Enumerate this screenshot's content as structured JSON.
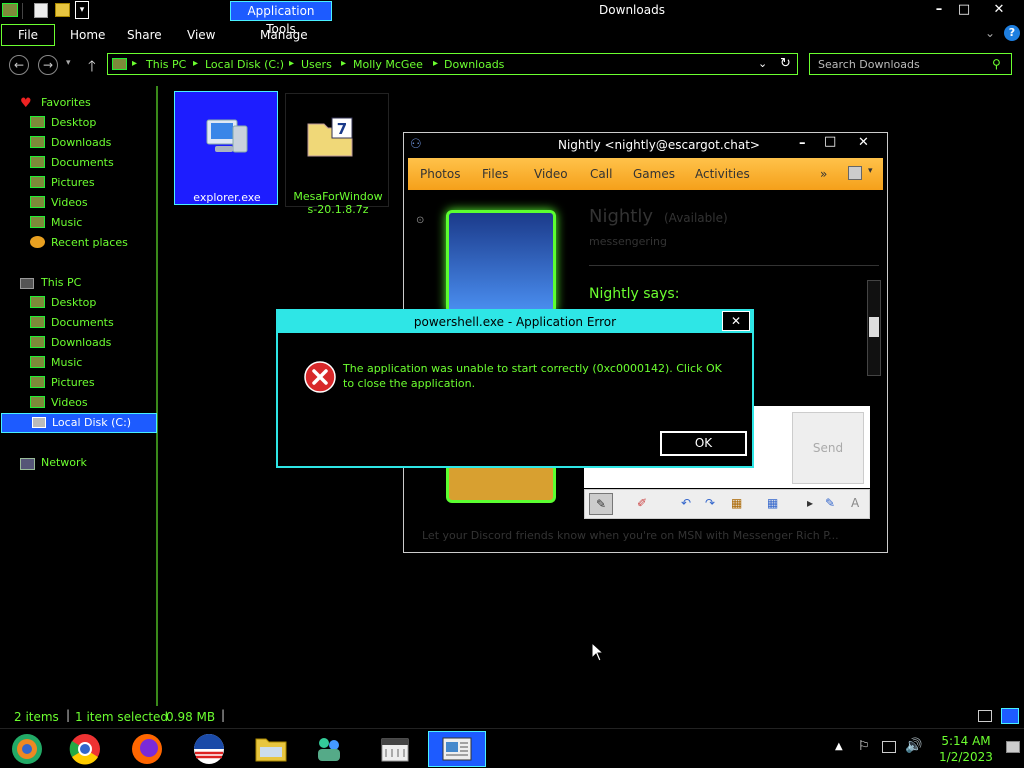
{
  "window": {
    "title": "Downloads",
    "app_tools_label": "Application Tools",
    "minimize": "–",
    "maximize": "□",
    "close": "✕"
  },
  "ribbon": {
    "tabs": [
      "File",
      "Home",
      "Share",
      "View",
      "Manage"
    ]
  },
  "address": {
    "crumbs": [
      "This PC",
      "Local Disk (C:)",
      "Users",
      "Molly McGee",
      "Downloads"
    ],
    "search_placeholder": "Search Downloads"
  },
  "nav": {
    "favorites_label": "Favorites",
    "favorites": [
      "Desktop",
      "Downloads",
      "Documents",
      "Pictures",
      "Videos",
      "Music",
      "Recent places"
    ],
    "thispc_label": "This PC",
    "thispc": [
      "Desktop",
      "Documents",
      "Downloads",
      "Music",
      "Pictures",
      "Videos",
      "Local Disk (C:)"
    ],
    "network_label": "Network"
  },
  "files": [
    {
      "name": "explorer.exe"
    },
    {
      "name_line1": "MesaForWindow",
      "name_line2": "s-20.1.8.7z"
    }
  ],
  "messenger": {
    "title": "Nightly <nightly@escargot.chat>",
    "tabs": [
      "Photos",
      "Files",
      "Video",
      "Call",
      "Games",
      "Activities"
    ],
    "more": "»",
    "contact_name": "Nightly",
    "contact_status": "(Available)",
    "personal_message": "messengering",
    "says": "Nightly says:",
    "send_label": "Send",
    "ad_text": "Let your Discord friends know when you're on MSN with Messenger Rich P..."
  },
  "error": {
    "title": "powershell.exe - Application Error",
    "message": "The application was unable to start correctly (0xc0000142). Click OK to close the application.",
    "ok_label": "OK",
    "close": "✕"
  },
  "status": {
    "items": "2 items",
    "selected": "1 item selected",
    "size": "0.98 MB"
  },
  "clock": {
    "time": "5:14 AM",
    "date": "1/2/2023"
  },
  "colors": {
    "accent_green": "#6CFF30",
    "selection_blue": "#1d5bff",
    "dialog_cyan": "#2ee6e6",
    "messenger_orange": "#f5a01a"
  }
}
